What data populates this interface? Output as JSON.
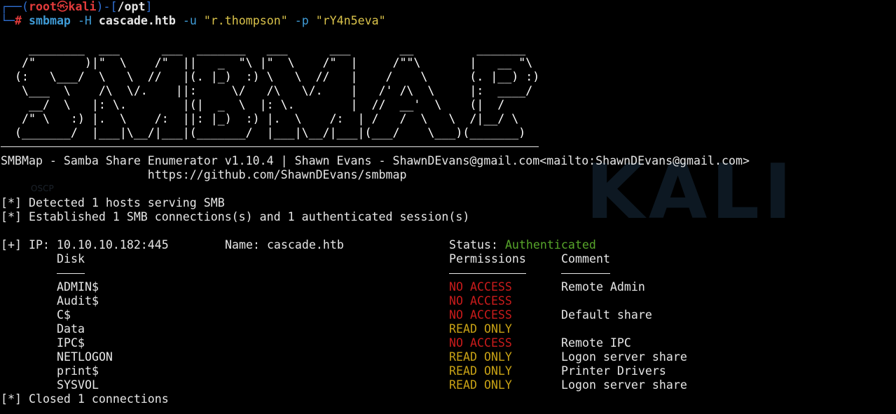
{
  "prompt": {
    "user": "root",
    "host": "kali",
    "dir": "/opt",
    "hash": "#"
  },
  "command": {
    "program": "smbmap",
    "flag_host": "-H",
    "host": "cascade.htb",
    "flag_user": "-u",
    "user": "\"r.thompson\"",
    "flag_pass": "-p",
    "pass": "\"rY4n5eva\""
  },
  "banner_art": [
    "    ________  ___      ___  _______   ___      ___       __         _______",
    "   /\"       )|\"  \\    /\"  ||   _  \"\\ |\"  \\    /\"  |     /\"\"\\       |   __ \"\\",
    "  (:   \\___/  \\   \\  //   |(. |_)  :) \\   \\  //   |    /    \\      (. |__) :)",
    "   \\___  \\    /\\  \\/.    ||:     \\/   /\\   \\/.    |   /' /\\  \\     |:  ____/",
    "    __/  \\   |: \\.        |(|  _  \\  |: \\.        |  //  __'  \\    (|  /",
    "   /\" \\   :) |.  \\    /:  ||: |_)  :) |.  \\    /:  | /   /  \\   \\  /|__/ \\",
    "  (_______/  |___|\\__/|___|(_______/  |___|\\__/|___|(___/    \\___)(_______)"
  ],
  "header_line": "SMBMap - Samba Share Enumerator v1.10.4 | Shawn Evans - ShawnDEvans@gmail.com<mailto:ShawnDEvans@gmail.com>",
  "url_line": "                     https://github.com/ShawnDEvans/smbmap",
  "info_lines": [
    "[*] Detected 1 hosts serving SMB",
    "[*] Established 1 SMB connections(s) and 1 authenticated session(s)"
  ],
  "target": {
    "ip_prefix": "[+] IP: 10.10.10.182:445",
    "name": "Name: cascade.htb",
    "status_label": "Status: ",
    "status_value": "Authenticated"
  },
  "table": {
    "headers": [
      "Disk",
      "Permissions",
      "Comment"
    ],
    "underlines": [
      "----",
      "-----------",
      "-------"
    ],
    "rows": [
      {
        "disk": "ADMIN$",
        "perm": "NO ACCESS",
        "comment": "Remote Admin"
      },
      {
        "disk": "Audit$",
        "perm": "NO ACCESS",
        "comment": ""
      },
      {
        "disk": "C$",
        "perm": "NO ACCESS",
        "comment": "Default share"
      },
      {
        "disk": "Data",
        "perm": "READ ONLY",
        "comment": ""
      },
      {
        "disk": "IPC$",
        "perm": "NO ACCESS",
        "comment": "Remote IPC"
      },
      {
        "disk": "NETLOGON",
        "perm": "READ ONLY",
        "comment": "Logon server share"
      },
      {
        "disk": "print$",
        "perm": "READ ONLY",
        "comment": "Printer Drivers"
      },
      {
        "disk": "SYSVOL",
        "perm": "READ ONLY",
        "comment": "Logon server share"
      }
    ]
  },
  "closing_line": "[*] Closed 1 connections",
  "wallpaper": {
    "brand": "KALI",
    "labels": [
      "OSCP"
    ]
  },
  "colors": {
    "background": "#000000",
    "no_access": "#c91b1b",
    "read_only": "#c8a215",
    "authenticated": "#57a52a",
    "prompt_blue": "#2f6fd1",
    "command_blue": "#3f9bd6",
    "string_yellow": "#d9c24a"
  }
}
